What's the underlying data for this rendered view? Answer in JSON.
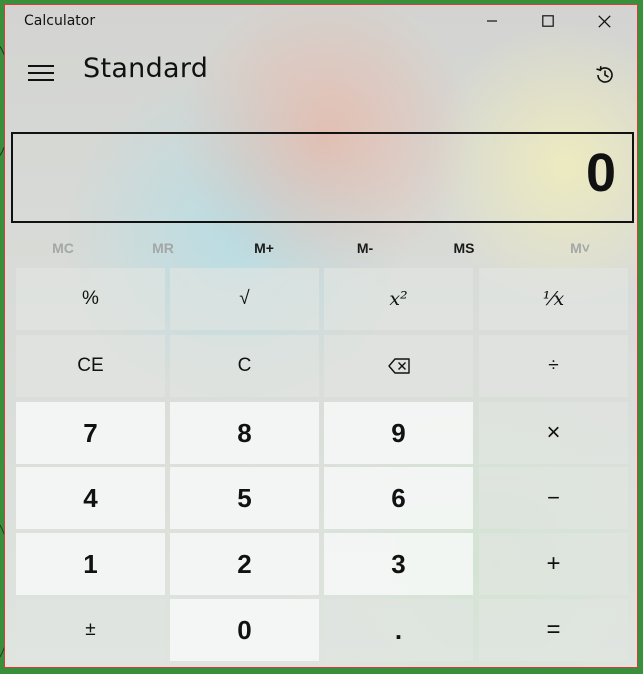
{
  "window": {
    "title": "Calculator",
    "minimize_icon": "minimize-icon",
    "maximize_icon": "maximize-icon",
    "close_icon": "close-icon"
  },
  "header": {
    "menu_icon": "hamburger-menu-icon",
    "mode": "Standard",
    "history_icon": "history-icon"
  },
  "display": {
    "value": "0"
  },
  "memory": {
    "buttons": [
      {
        "label": "MC",
        "enabled": false
      },
      {
        "label": "MR",
        "enabled": false
      },
      {
        "label": "M+",
        "enabled": true
      },
      {
        "label": "M-",
        "enabled": true
      },
      {
        "label": "MS",
        "enabled": true
      },
      {
        "label": "M˅",
        "enabled": false
      }
    ]
  },
  "keypad": {
    "rows": [
      [
        {
          "label": "%",
          "kind": "fn"
        },
        {
          "label": "√",
          "kind": "fn"
        },
        {
          "label": "x²",
          "kind": "fn"
        },
        {
          "label": "¹⁄x",
          "kind": "fn"
        }
      ],
      [
        {
          "label": "CE",
          "kind": "fn"
        },
        {
          "label": "C",
          "kind": "fn"
        },
        {
          "label": "⌫",
          "kind": "fn",
          "icon": "backspace-icon"
        },
        {
          "label": "÷",
          "kind": "fn"
        }
      ],
      [
        {
          "label": "7",
          "kind": "num"
        },
        {
          "label": "8",
          "kind": "num"
        },
        {
          "label": "9",
          "kind": "num"
        },
        {
          "label": "×",
          "kind": "fn"
        }
      ],
      [
        {
          "label": "4",
          "kind": "num"
        },
        {
          "label": "5",
          "kind": "num"
        },
        {
          "label": "6",
          "kind": "num"
        },
        {
          "label": "−",
          "kind": "fn"
        }
      ],
      [
        {
          "label": "1",
          "kind": "num"
        },
        {
          "label": "2",
          "kind": "num"
        },
        {
          "label": "3",
          "kind": "num"
        },
        {
          "label": "+",
          "kind": "fn"
        }
      ],
      [
        {
          "label": "±",
          "kind": "fn"
        },
        {
          "label": "0",
          "kind": "num"
        },
        {
          "label": ".",
          "kind": "fn"
        },
        {
          "label": "=",
          "kind": "fn"
        }
      ]
    ]
  },
  "colors": {
    "border": "#d43d3d",
    "text": "#111111",
    "disabled": "#a3a7a5"
  }
}
